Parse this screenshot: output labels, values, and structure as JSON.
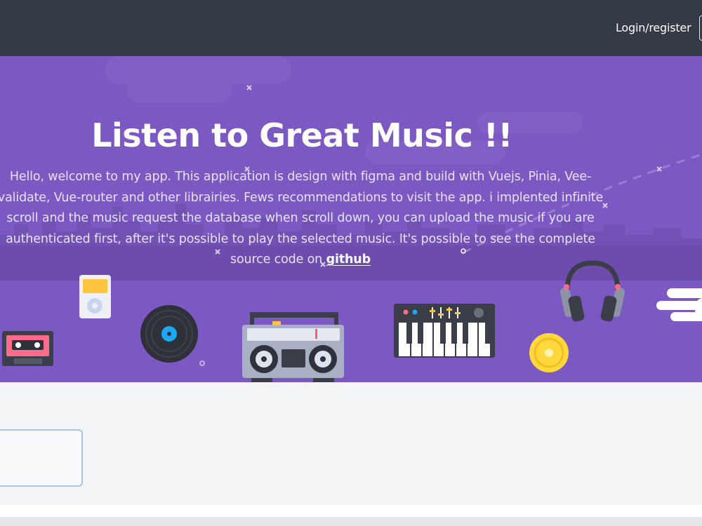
{
  "header": {
    "login_label": "Login/register"
  },
  "hero": {
    "title": "Listen to Great Music !!",
    "description": "Hello, welcome to my app. This application is design with figma and build with Vuejs, Pinia, Vee-validate, Vue-router and other librairies. Fews recommendations to visit the app. i implented infinite scroll and the music request the database when scroll down, you can upload the music if you are authenticated first, after it's possible to play the selected music. It's possible to see the complete source code on",
    "github_label": "github"
  },
  "search": {
    "value": "",
    "placeholder": ""
  },
  "colors": {
    "header_bg": "#343a46",
    "hero_bg": "#7c58c3",
    "page_bg": "#f3f4f6"
  },
  "icons": [
    "cassette-icon",
    "ipod-icon",
    "vinyl-record-icon",
    "boombox-icon",
    "synthesizer-icon",
    "cd-icon",
    "headphones-icon"
  ]
}
